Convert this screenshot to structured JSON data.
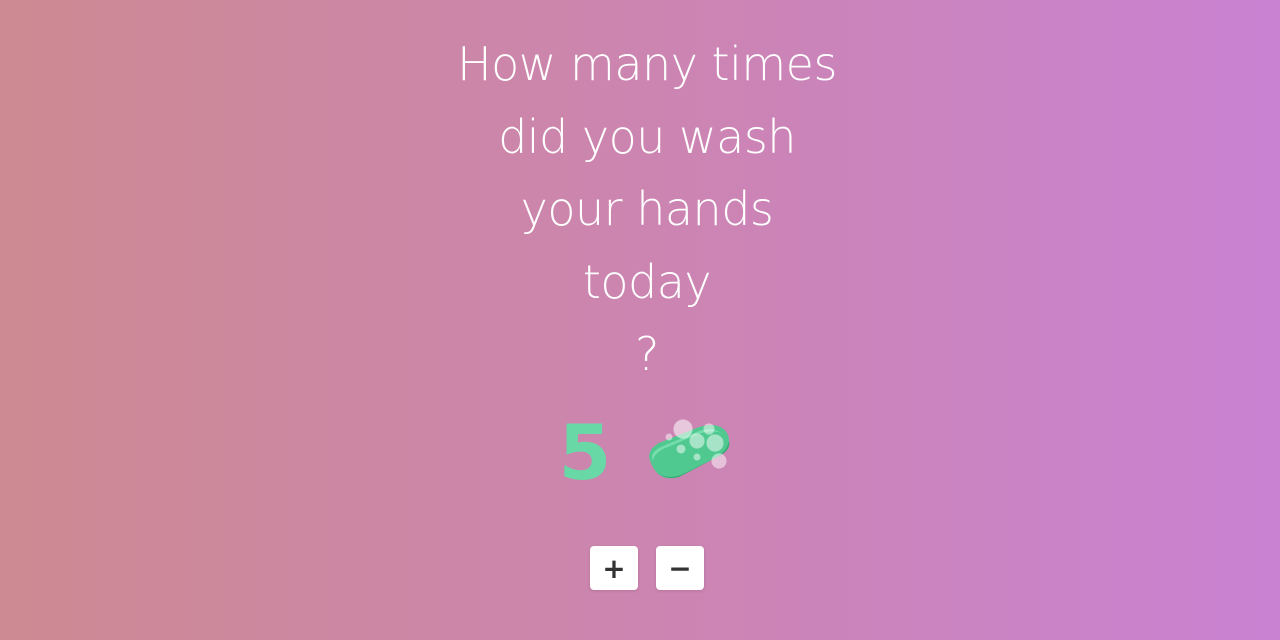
{
  "question": {
    "lines": [
      "How many times",
      "did you wash",
      "your hands",
      "today",
      "?"
    ]
  },
  "counter": {
    "value": "5",
    "icon": "soap-icon"
  },
  "controls": {
    "increment_label": "+",
    "decrement_label": "−"
  },
  "colors": {
    "background_start": "#cd8a92",
    "background_end": "#c982d2",
    "count": "#67d8a6",
    "question_text": "#ffffff",
    "button_bg": "#ffffff"
  }
}
